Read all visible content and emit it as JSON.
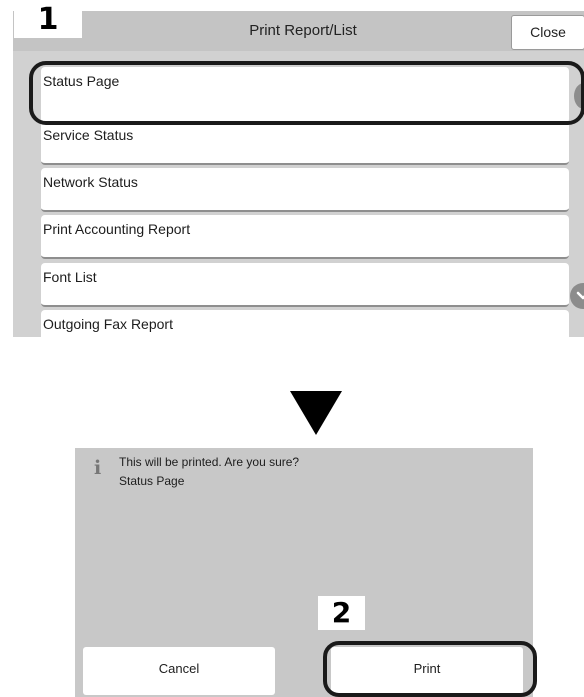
{
  "step_badges": {
    "first": "1",
    "second": "2"
  },
  "screen1": {
    "title": "Print Report/List",
    "close_label": "Close",
    "items": [
      {
        "label": "Status Page"
      },
      {
        "label": "Service Status"
      },
      {
        "label": "Network Status"
      },
      {
        "label": "Print Accounting Report"
      },
      {
        "label": "Font List"
      },
      {
        "label": "Outgoing Fax Report"
      }
    ],
    "selected_item": "Status Page",
    "icons": {
      "scroll_up": "chevron-up-icon",
      "scroll_down": "chevron-down-icon"
    }
  },
  "screen2": {
    "message": "This will be printed. Are you sure?",
    "report_name": "Status Page",
    "cancel_label": "Cancel",
    "print_label": "Print",
    "info_icon": "i"
  },
  "colors": {
    "panel_background": "#d1d1d1",
    "dialog_background": "#c8c8c8",
    "highlight": "#1a1a1a"
  }
}
